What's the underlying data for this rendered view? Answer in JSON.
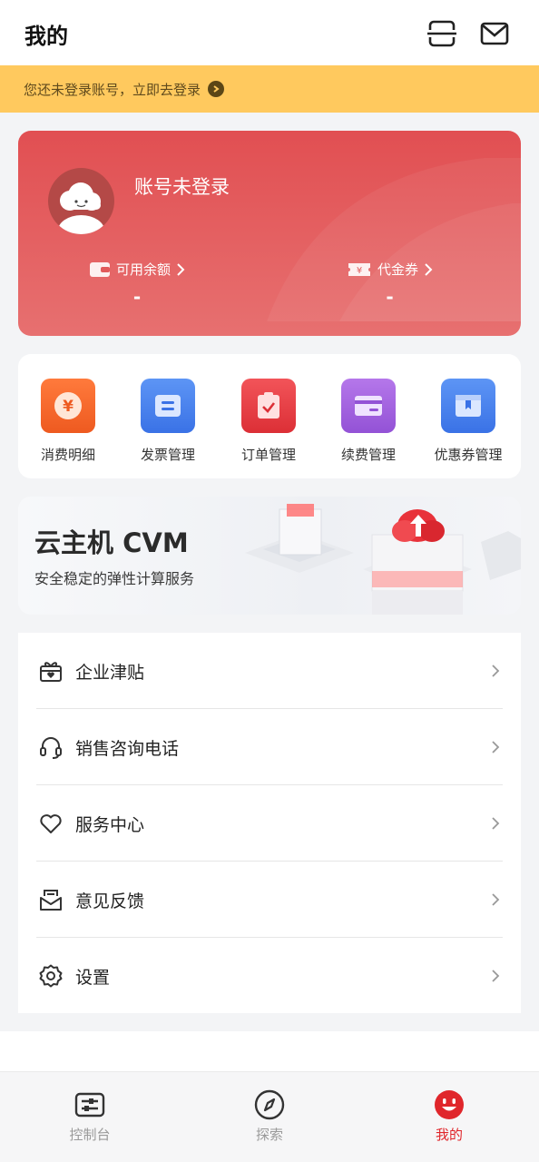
{
  "header": {
    "title": "我的",
    "icons": [
      "scan-icon",
      "mail-icon"
    ]
  },
  "login_bar": {
    "text": "您还未登录账号，立即去登录"
  },
  "account": {
    "name": "账号未登录",
    "balance": {
      "label": "可用余额",
      "value": "-"
    },
    "voucher": {
      "label": "代金券",
      "value": "-"
    }
  },
  "tools": [
    {
      "label": "消费明细",
      "color": "#f26b2c",
      "icon": "yuan-icon"
    },
    {
      "label": "发票管理",
      "color": "#4b84ee",
      "icon": "invoice-icon"
    },
    {
      "label": "订单管理",
      "color": "#ea3f45",
      "icon": "order-icon"
    },
    {
      "label": "续费管理",
      "color": "#a564de",
      "icon": "renew-icon"
    },
    {
      "label": "优惠券管理",
      "color": "#4a86ee",
      "icon": "coupon-icon"
    }
  ],
  "banner": {
    "title": "云主机 CVM",
    "subtitle": "安全稳定的弹性计算服务"
  },
  "menu": [
    {
      "label": "企业津贴",
      "icon": "gift-icon"
    },
    {
      "label": "销售咨询电话",
      "icon": "headset-icon"
    },
    {
      "label": "服务中心",
      "icon": "heart-icon"
    },
    {
      "label": "意见反馈",
      "icon": "feedback-icon"
    },
    {
      "label": "设置",
      "icon": "gear-icon"
    }
  ],
  "tabbar": {
    "items": [
      {
        "label": "控制台",
        "icon": "console-icon"
      },
      {
        "label": "探索",
        "icon": "compass-icon"
      },
      {
        "label": "我的",
        "icon": "smile-icon"
      }
    ],
    "active_color": "#e0262b"
  }
}
